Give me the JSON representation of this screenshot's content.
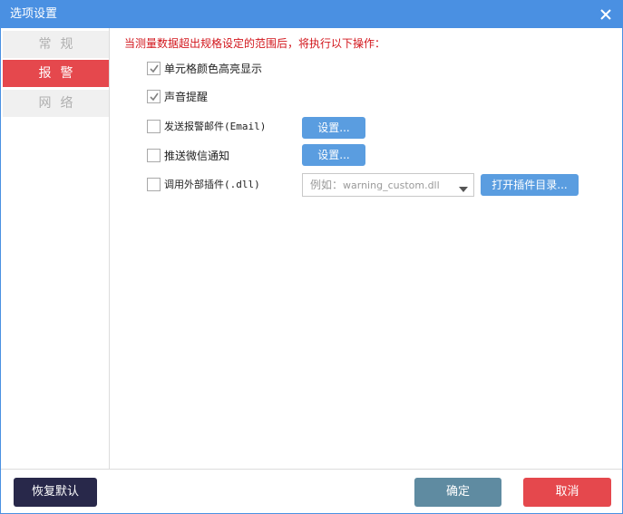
{
  "window": {
    "title": "选项设置"
  },
  "sidebar": {
    "items": [
      {
        "label": "常规",
        "active": false
      },
      {
        "label": "报警",
        "active": true
      },
      {
        "label": "网络",
        "active": false
      }
    ]
  },
  "alarm": {
    "intro": "当测量数据超出规格设定的范围后，将执行以下操作：",
    "options": [
      {
        "label": "单元格颜色高亮显示",
        "checked": true
      },
      {
        "label": "声音提醒",
        "checked": true
      },
      {
        "label": "发送报警邮件(Email)",
        "checked": false
      },
      {
        "label": "推送微信通知",
        "checked": false
      },
      {
        "label": "调用外部插件(.dll)",
        "checked": false
      }
    ],
    "email_settings_label": "设置...",
    "wechat_settings_label": "设置...",
    "plugin_select": {
      "example_prefix": "例如：",
      "placeholder_value": "warning_custom.dll"
    },
    "open_plugin_dir_label": "打开插件目录..."
  },
  "footer": {
    "restore_label": "恢复默认",
    "ok_label": "确定",
    "cancel_label": "取消"
  },
  "colors": {
    "titlebar": "#4a90e2",
    "accent_red": "#e5484d",
    "intro_red": "#d2161c",
    "button_blue": "#5a9de0",
    "restore_dark": "#28284a",
    "ok_slate": "#5f8ba1"
  }
}
